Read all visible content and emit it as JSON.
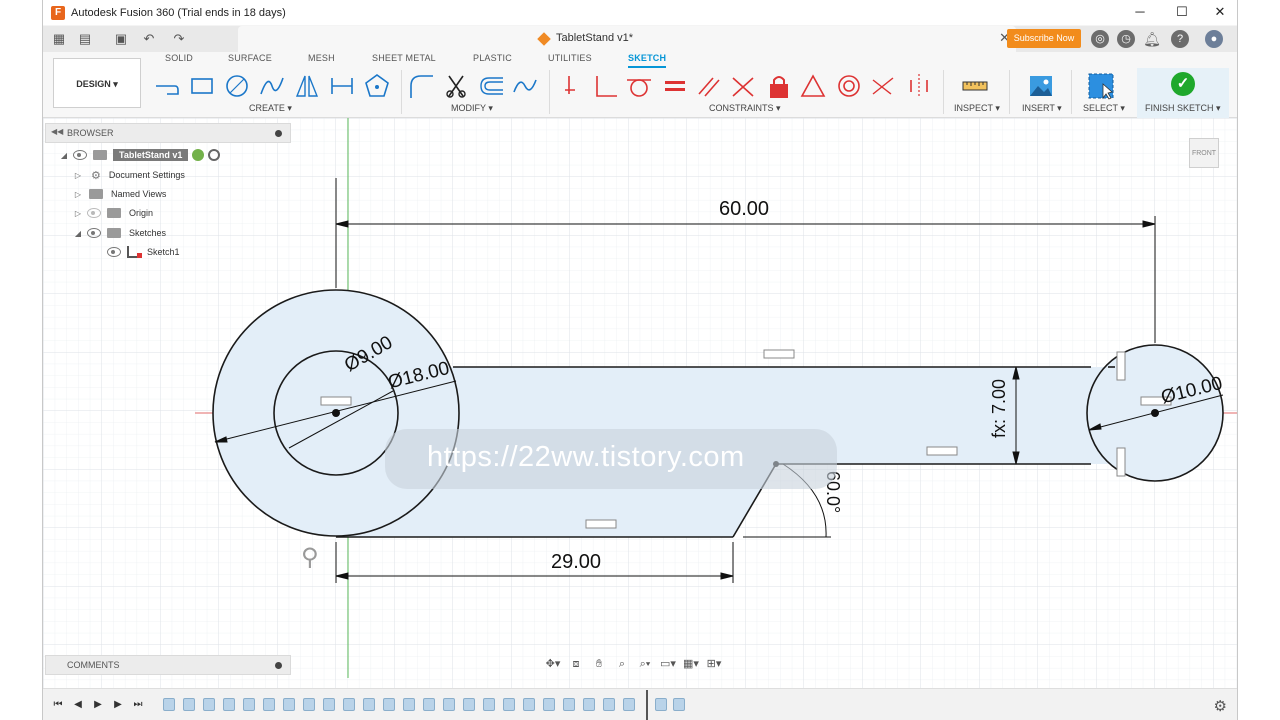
{
  "window": {
    "title": "Autodesk Fusion 360 (Trial ends in 18 days)",
    "min_glyph": "─",
    "max_glyph": "☐",
    "close_glyph": "✕"
  },
  "tabbar": {
    "document_name": "TabletStand v1*",
    "subscribe_label": "Subscribe Now"
  },
  "ribbon": {
    "workspace_label": "DESIGN ▾",
    "tabs": [
      {
        "label": "SOLID"
      },
      {
        "label": "SURFACE"
      },
      {
        "label": "MESH"
      },
      {
        "label": "SHEET METAL"
      },
      {
        "label": "PLASTIC"
      },
      {
        "label": "UTILITIES"
      },
      {
        "label": "SKETCH"
      }
    ],
    "groups": {
      "create": "CREATE ▾",
      "modify": "MODIFY ▾",
      "constraints": "CONSTRAINTS ▾",
      "inspect": "INSPECT ▾",
      "insert": "INSERT ▾",
      "select": "SELECT ▾",
      "finish": "FINISH SKETCH ▾"
    },
    "accent": "#0696d7"
  },
  "browser": {
    "label": "BROWSER",
    "root": "TabletStand v1",
    "items": [
      {
        "label": "Document Settings"
      },
      {
        "label": "Named Views"
      },
      {
        "label": "Origin"
      },
      {
        "label": "Sketches"
      },
      {
        "label": "Sketch1"
      }
    ]
  },
  "viewcube_label": "FRONT",
  "comments_label": "COMMENTS",
  "sketch": {
    "dimensions": {
      "overall_length": "60.00",
      "bottom_length": "29.00",
      "small_hole_dia": "Ø9.00",
      "large_circle_dia": "Ø18.00",
      "right_circle_dia": "Ø10.00",
      "thickness": "fx: 7.00",
      "angle": "60.0°"
    },
    "sketch_line_color": "#1a1a1a",
    "profile_fill_color": "#e3eef8",
    "dimension_color": "#111111",
    "origin_axis_color": "#e06a6a",
    "vertical_axis_color": "#5ab85a"
  },
  "watermark": "https://22ww.tistory.com"
}
